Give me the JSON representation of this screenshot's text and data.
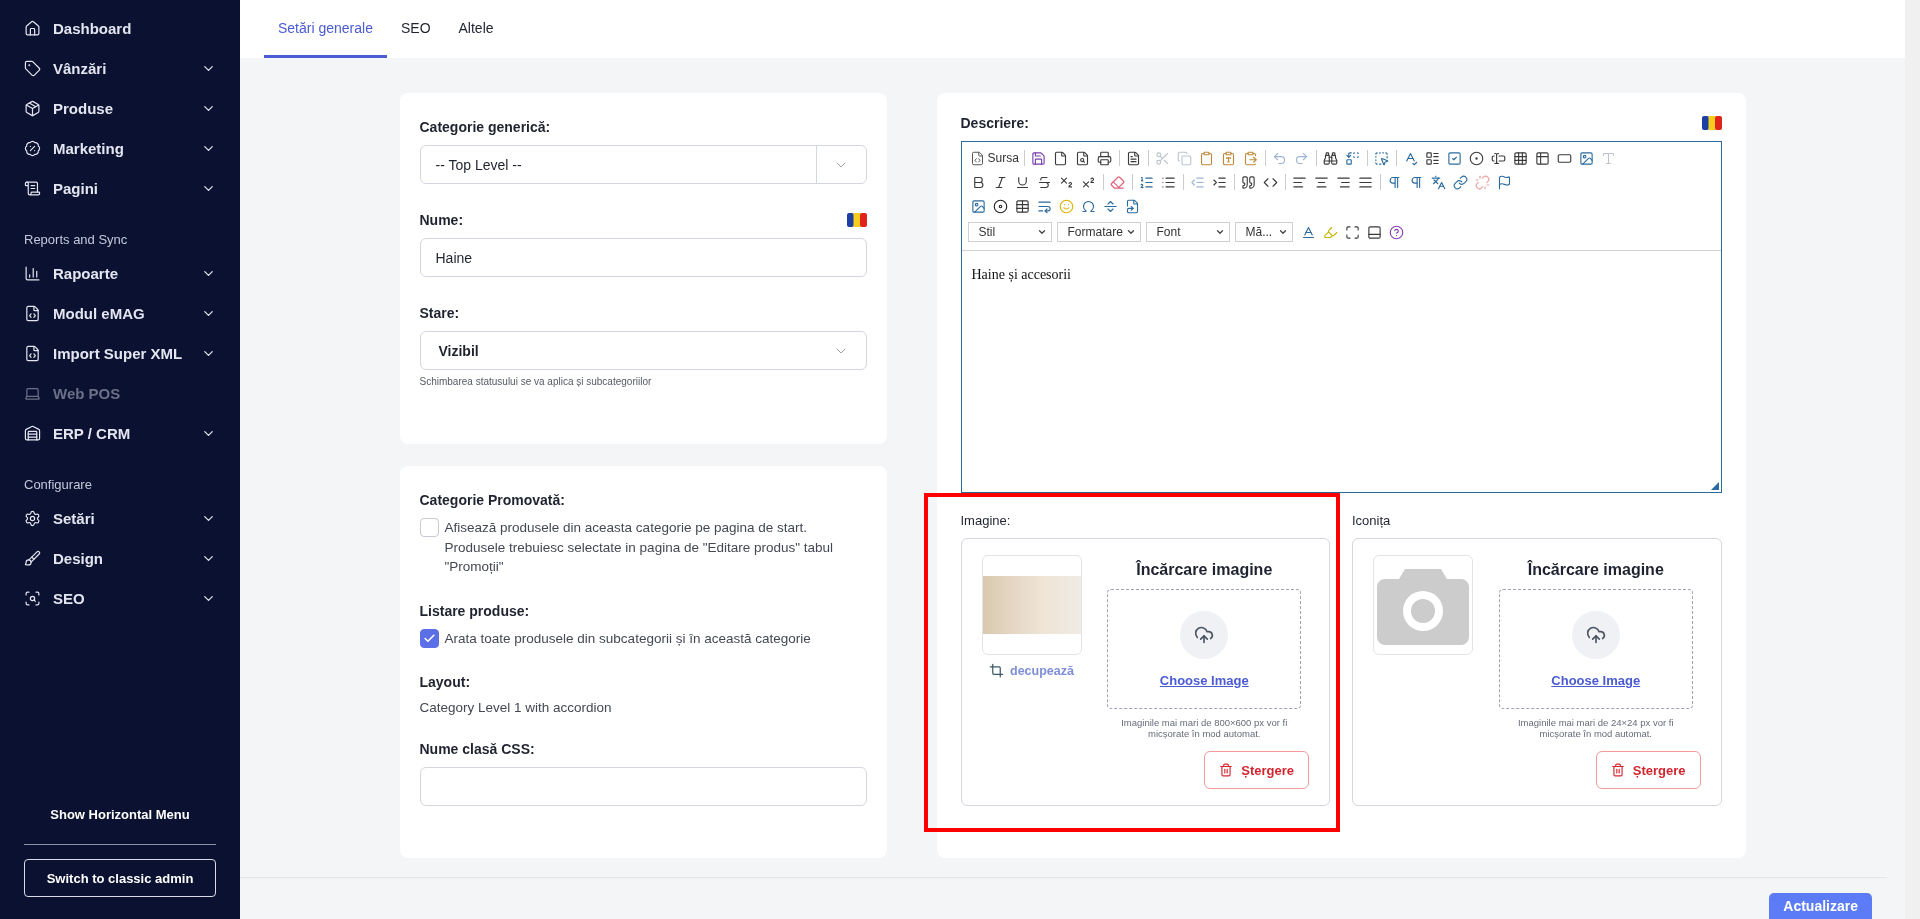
{
  "sidebar": {
    "groups": [
      {
        "items": [
          {
            "label": "Dashboard",
            "expandable": false,
            "disabled": false
          },
          {
            "label": "Vânzări",
            "expandable": true,
            "disabled": false
          },
          {
            "label": "Produse",
            "expandable": true,
            "disabled": false
          },
          {
            "label": "Marketing",
            "expandable": true,
            "disabled": false
          },
          {
            "label": "Pagini",
            "expandable": true,
            "disabled": false
          }
        ]
      },
      {
        "heading": "Reports and Sync",
        "items": [
          {
            "label": "Rapoarte",
            "expandable": true,
            "disabled": false
          },
          {
            "label": "Modul eMAG",
            "expandable": true,
            "disabled": false
          },
          {
            "label": "Import Super XML",
            "expandable": true,
            "disabled": false
          },
          {
            "label": "Web POS",
            "expandable": false,
            "disabled": true
          },
          {
            "label": "ERP / CRM",
            "expandable": true,
            "disabled": false
          }
        ]
      },
      {
        "heading": "Configurare",
        "items": [
          {
            "label": "Setări",
            "expandable": true,
            "disabled": false
          },
          {
            "label": "Design",
            "expandable": true,
            "disabled": false
          },
          {
            "label": "SEO",
            "expandable": true,
            "disabled": false
          }
        ]
      }
    ],
    "horizontal_menu": "Show Horizontal Menu",
    "classic_admin": "Switch to classic admin"
  },
  "tabs": [
    {
      "label": "Setări generale",
      "selected": true
    },
    {
      "label": "SEO",
      "selected": false
    },
    {
      "label": "Altele",
      "selected": false
    }
  ],
  "general": {
    "parent_label": "Categorie generică:",
    "parent_value": "-- Top Level --",
    "name_label": "Nume:",
    "name_value": "Haine",
    "status_label": "Stare:",
    "status_value": "Vizibil",
    "status_hint": "Schimbarea statusului se va aplica și subcategoriilor"
  },
  "options": {
    "checks": [
      {
        "label": "Categorie Promovată:",
        "text": "Afisează produsele din aceasta categorie pe pagina de start. Produsele trebuiesc selectate in pagina de \"Editare produs\" tabul \"Promoții\"",
        "checked": false
      },
      {
        "label": "Listare produse:",
        "text": "Arata toate produsele din subcategorii și în această categorie",
        "checked": true
      }
    ],
    "layout_label": "Layout:",
    "layout_value": "Category Level 1 with accordion",
    "css_label": "Nume clasă CSS:"
  },
  "description": {
    "label": "Descriere:",
    "source": "Sursa",
    "dropdowns": [
      "Stil",
      "Formatare",
      "Font",
      "Mă..."
    ],
    "content": "Haine și accesorii"
  },
  "images": [
    {
      "label": "Imagine:",
      "kind": "photo",
      "crop": "decupează",
      "title": "Încărcare imagine",
      "choose": "Choose Image",
      "hint": "Imaginile mai mari de 800×600 px vor fi micșorate în mod automat.",
      "delete": "Ștergere",
      "highlighted": true
    },
    {
      "label": "Iconița",
      "kind": "placeholder",
      "title": "Încărcare imagine",
      "choose": "Choose Image",
      "hint": "Imaginile mai mari de 24×24 px vor fi micșorate în mod automat.",
      "delete": "Ștergere",
      "highlighted": false
    }
  ],
  "submit": "Actualizare"
}
